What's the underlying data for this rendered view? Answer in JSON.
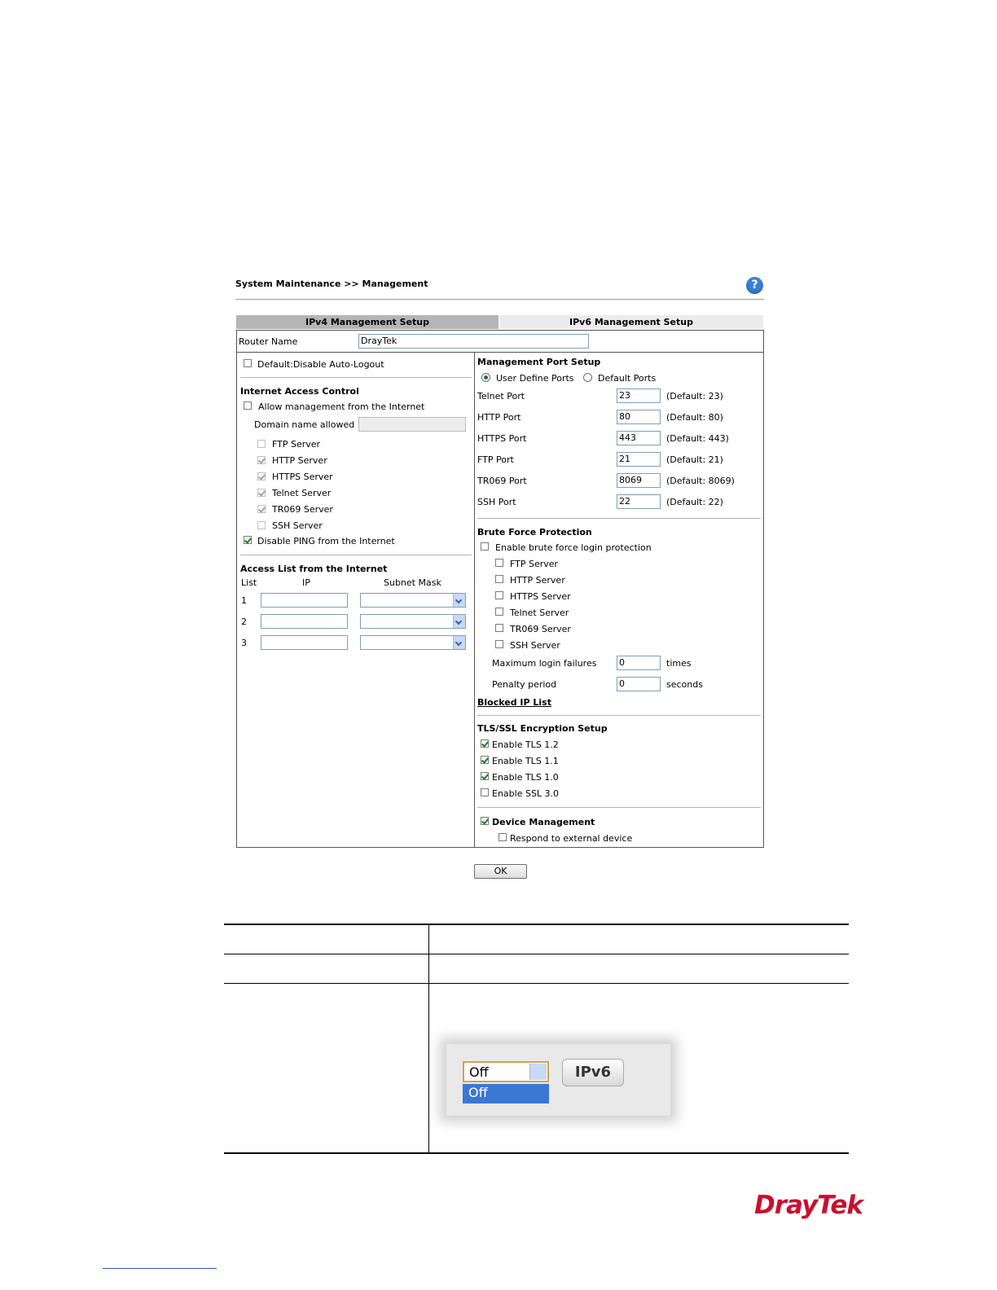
{
  "breadcrumb": "System Maintenance >> Management",
  "tabs": [
    "IPv4 Management Setup",
    "IPv6 Management Setup"
  ],
  "router_name": {
    "label": "Router Name",
    "value": "DrayTek"
  },
  "left": {
    "auto_logout": "Default:Disable Auto-Logout",
    "internet_access_title": "Internet Access Control",
    "allow_mgmt": "Allow management from the Internet",
    "domain_label": "Domain name allowed",
    "servers": [
      {
        "label": "FTP Server",
        "checked": false
      },
      {
        "label": "HTTP Server",
        "checked": true
      },
      {
        "label": "HTTPS Server",
        "checked": true
      },
      {
        "label": "Telnet Server",
        "checked": true
      },
      {
        "label": "TR069 Server",
        "checked": true
      },
      {
        "label": "SSH Server",
        "checked": false
      }
    ],
    "disable_ping": "Disable PING from the Internet",
    "access_list_title": "Access List from the Internet",
    "col_list": "List",
    "col_ip": "IP",
    "col_mask": "Subnet Mask",
    "rows": [
      "1",
      "2",
      "3"
    ]
  },
  "right": {
    "port_title": "Management Port Setup",
    "user_define": "User Define Ports",
    "default_ports": "Default Ports",
    "ports": [
      {
        "label": "Telnet Port",
        "value": "23",
        "default": "(Default: 23)"
      },
      {
        "label": "HTTP Port",
        "value": "80",
        "default": "(Default: 80)"
      },
      {
        "label": "HTTPS Port",
        "value": "443",
        "default": "(Default: 443)"
      },
      {
        "label": "FTP Port",
        "value": "21",
        "default": "(Default: 21)"
      },
      {
        "label": "TR069 Port",
        "value": "8069",
        "default": "(Default: 8069)"
      },
      {
        "label": "SSH Port",
        "value": "22",
        "default": "(Default: 22)"
      }
    ],
    "brute_title": "Brute Force Protection",
    "brute_enable": "Enable brute force login protection",
    "brute_servers": [
      "FTP Server",
      "HTTP Server",
      "HTTPS Server",
      "Telnet Server",
      "TR069 Server",
      "SSH Server"
    ],
    "max_fail_label": "Maximum login failures",
    "max_fail_value": "0",
    "max_fail_unit": "times",
    "penalty_label": "Penalty period",
    "penalty_value": "0",
    "penalty_unit": "seconds",
    "blocked_link": "Blocked IP List",
    "tls_title": "TLS/SSL Encryption Setup",
    "tls": [
      {
        "label": "Enable TLS 1.2",
        "checked": true
      },
      {
        "label": "Enable TLS 1.1",
        "checked": true
      },
      {
        "label": "Enable TLS 1.0",
        "checked": true
      },
      {
        "label": "Enable SSL 3.0",
        "checked": false
      }
    ],
    "device_mgmt": "Device Management",
    "respond": "Respond to external device"
  },
  "ok_button": "OK",
  "snippet": {
    "select_value": "Off",
    "option": "Off",
    "ipv6_badge": "IPv6"
  },
  "logo": "DrayTek",
  "colors": {
    "tab_active": "#b5b5b5",
    "tab_inactive": "#ececec",
    "brand_red": "#c8102e",
    "help_blue": "#3b82d6"
  }
}
